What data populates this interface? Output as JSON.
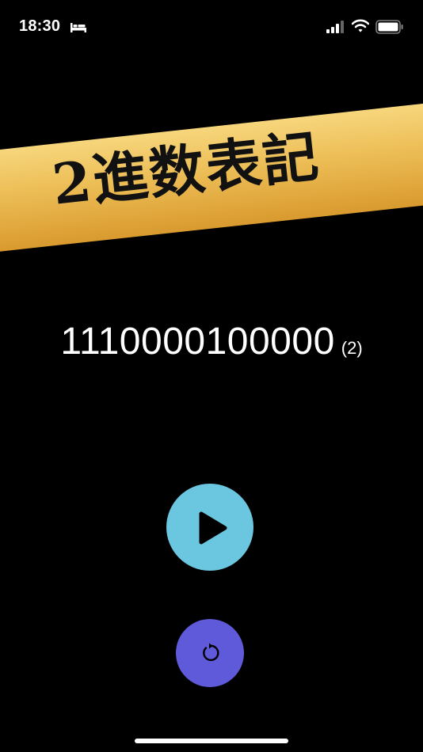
{
  "status_bar": {
    "time": "18:30",
    "icons": [
      "bed-icon",
      "cellular-signal-icon",
      "wifi-icon",
      "battery-icon"
    ]
  },
  "banner": {
    "title": "2進数表記",
    "colors": {
      "top": "#f7d67c",
      "mid": "#ecbd55",
      "bottom": "#d99a2e",
      "text": "#111111"
    }
  },
  "display": {
    "value": "1110000100000",
    "base_label": "(2)"
  },
  "controls": {
    "play": {
      "icon": "play-icon",
      "color": "#6ac7df"
    },
    "reset": {
      "icon": "reset-icon",
      "color": "#5e5ad9"
    }
  },
  "theme": {
    "background": "#000000",
    "foreground": "#ffffff"
  }
}
